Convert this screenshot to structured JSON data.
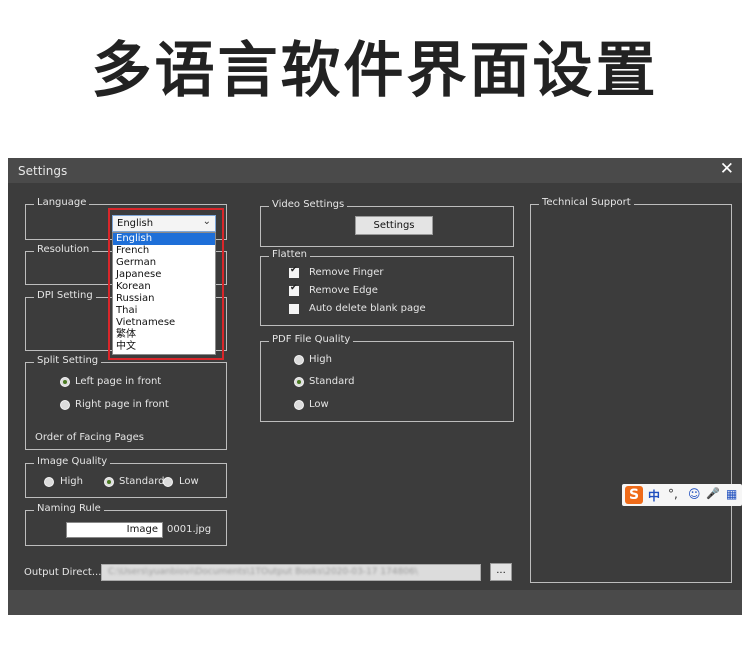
{
  "banner": {
    "title": "多语言软件界面设置"
  },
  "window": {
    "title": "Settings",
    "close_glyph": "✕"
  },
  "language": {
    "legend": "Language",
    "selected": "English",
    "options": [
      "English",
      "French",
      "German",
      "Japanese",
      "Korean",
      "Russian",
      "Thai",
      "Vietnamese",
      "繁体",
      "中文"
    ],
    "highlight_color": "#d9262a"
  },
  "resolution": {
    "legend": "Resolution"
  },
  "dpi": {
    "legend": "DPI Setting"
  },
  "split": {
    "legend": "Split Setting",
    "left_label": "Left page in front",
    "right_label": "Right page in front",
    "order_label": "Order of Facing Pages",
    "selected": "Left page in front"
  },
  "image_quality": {
    "legend": "Image Quality",
    "high": "High",
    "standard": "Standard",
    "low": "Low",
    "selected": "Standard"
  },
  "naming": {
    "legend": "Naming Rule",
    "value": "Image",
    "suffix": "0001.jpg"
  },
  "output": {
    "label": "Output Direct...",
    "path": "C:\\Users\\yuanbiovi\\Documents\\1TOutput Books\\2020-03-17 174806\\",
    "browse": "..."
  },
  "video": {
    "legend": "Video Settings",
    "button": "Settings"
  },
  "flatten": {
    "legend": "Flatten",
    "items": [
      {
        "label": "Remove Finger",
        "checked": true
      },
      {
        "label": "Remove Edge",
        "checked": true
      },
      {
        "label": "Auto delete blank page",
        "checked": false
      }
    ]
  },
  "pdf": {
    "legend": "PDF File Quality",
    "high": "High",
    "standard": "Standard",
    "low": "Low",
    "selected": "Standard"
  },
  "support": {
    "legend": "Technical Support"
  },
  "ime": {
    "logo": "S",
    "items": [
      "中",
      "°,",
      "☺",
      "🎤",
      "▦"
    ],
    "accent": "#ef6b19"
  },
  "colors": {
    "window_bg": "#3c3c3c",
    "titlebar_bg": "#4a4a4a",
    "selection": "#1e6fd8"
  }
}
